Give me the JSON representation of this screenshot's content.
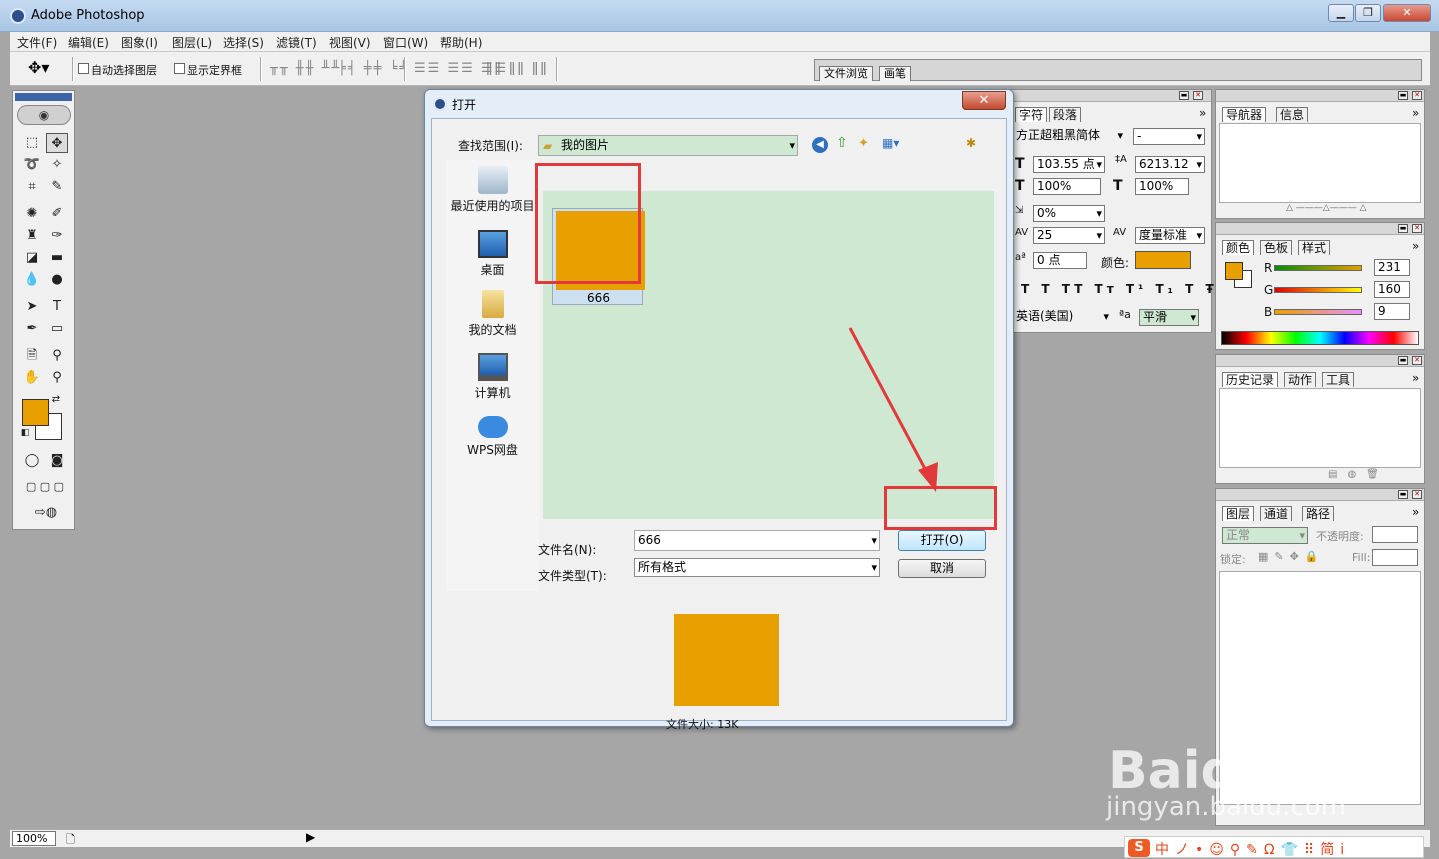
{
  "window": {
    "title": "Adobe Photoshop"
  },
  "menu": [
    "文件(F)",
    "编辑(E)",
    "图象(I)",
    "图层(L)",
    "选择(S)",
    "滤镜(T)",
    "视图(V)",
    "窗口(W)",
    "帮助(H)"
  ],
  "options_bar": {
    "auto_select_label": "自动选择图层",
    "show_bounds_label": "显示定界框",
    "palette_tabs": [
      "文件浏览",
      "画笔"
    ]
  },
  "status_bar": {
    "zoom": "100%"
  },
  "character_palette": {
    "tabs": [
      "字符",
      "段落"
    ],
    "font": "方正超粗黑简体",
    "style": "-",
    "size": "103.55 点",
    "leading": "6213.12",
    "vertical_scale": "100%",
    "horizontal_scale": "100%",
    "tracking": "0%",
    "kerning": "25",
    "kerning_mode": "度量标准",
    "baseline_shift": "0 点",
    "color_label": "颜色:",
    "color": "#e8a000",
    "language": "英语(美国)",
    "antialias_label": "ªa",
    "antialias": "平滑"
  },
  "navigator_palette": {
    "tabs": [
      "导航器",
      "信息"
    ]
  },
  "color_palette": {
    "tabs": [
      "颜色",
      "色板",
      "样式"
    ],
    "foreground": "#e8a000",
    "channels": [
      {
        "label": "R",
        "value": "231"
      },
      {
        "label": "G",
        "value": "160"
      },
      {
        "label": "B",
        "value": "9"
      }
    ]
  },
  "history_palette": {
    "tabs": [
      "历史记录",
      "动作",
      "工具"
    ]
  },
  "layers_palette": {
    "tabs": [
      "图层",
      "通道",
      "路径"
    ],
    "blend_mode": "正常",
    "opacity_label": "不透明度:",
    "lock_label": "锁定:",
    "fill_label": "Fill:"
  },
  "dialog": {
    "title": "打开",
    "close_glyph": "✕",
    "look_in_label": "查找范围(I):",
    "look_in_value": "我的图片",
    "places": [
      "最近使用的项目",
      "桌面",
      "我的文档",
      "计算机",
      "WPS网盘"
    ],
    "files": [
      {
        "name": "666",
        "color": "#e8a000"
      }
    ],
    "filename_label": "文件名(N):",
    "filename_value": "666",
    "filetype_label": "文件类型(T):",
    "filetype_value": "所有格式",
    "open_button": "打开(O)",
    "cancel_button": "取消",
    "file_size": "文件大小: 13K"
  },
  "watermark": {
    "logo": "Baidu经验",
    "url": "jingyan.baidu.com"
  },
  "ime": {
    "label": "中ノ•☺⚲✎Ω👕⠿简ⅰ"
  },
  "toolbox": {
    "foreground": "#e8a000",
    "background": "#ffffff"
  }
}
